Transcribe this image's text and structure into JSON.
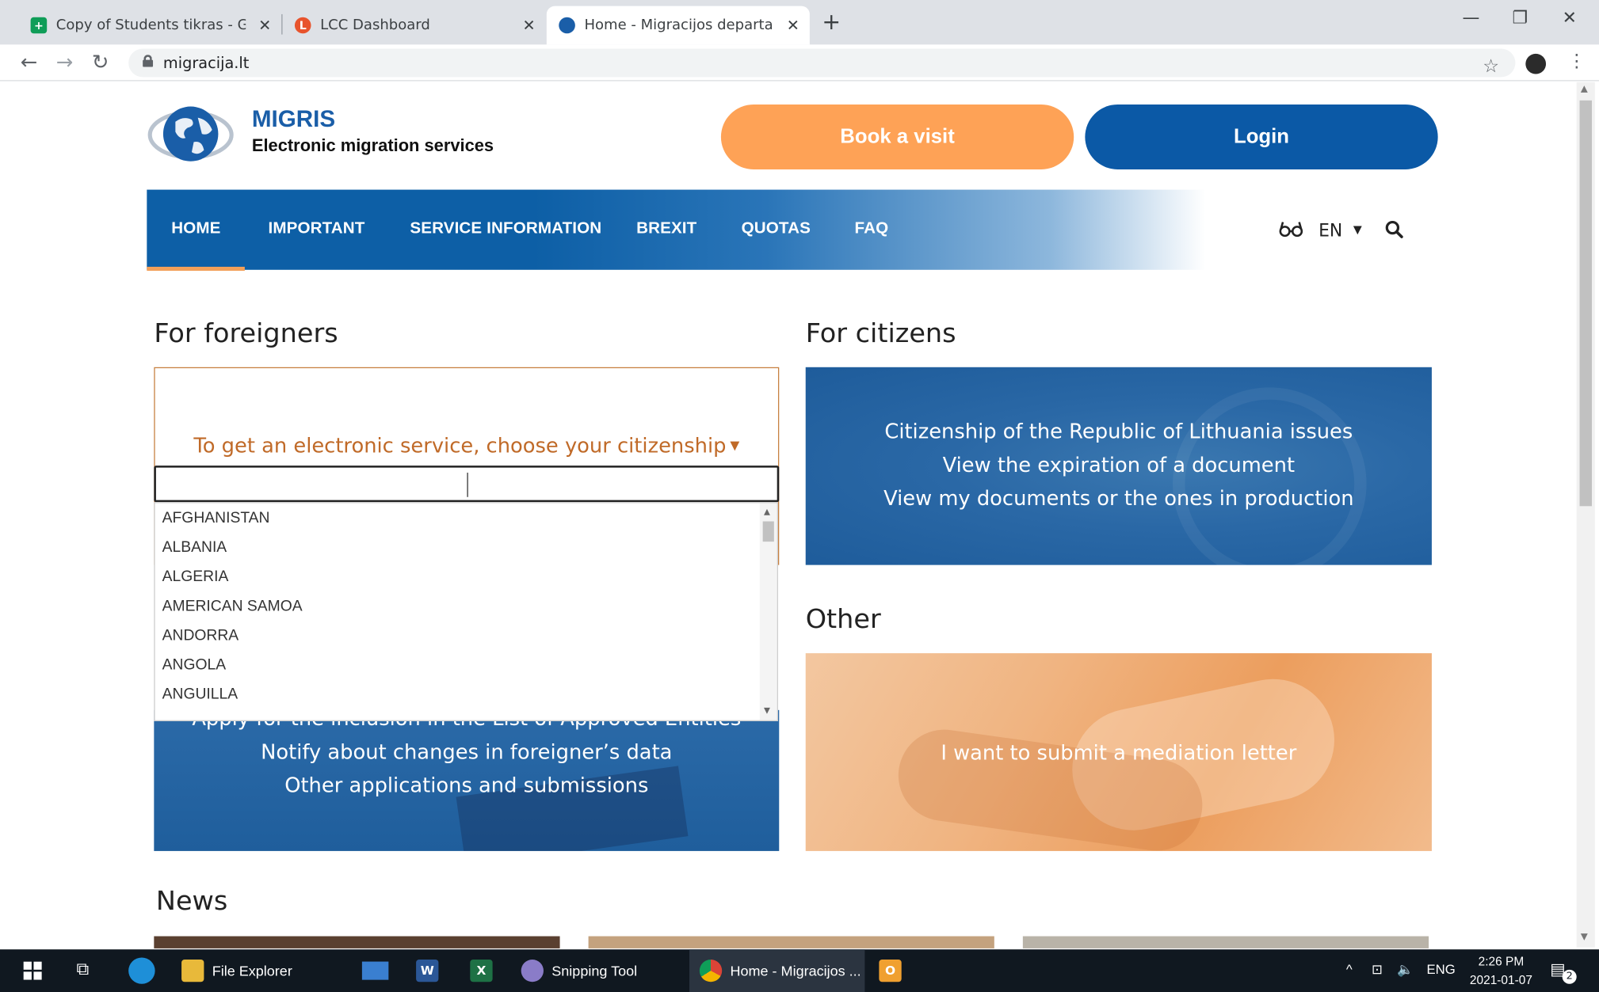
{
  "browser": {
    "tabs": [
      {
        "title": "Copy of Students tikras - Google",
        "icon": "sheets-icon",
        "color": "#0f9d58"
      },
      {
        "title": "LCC Dashboard",
        "icon": "lcc-icon",
        "color": "#e8542d"
      },
      {
        "title": "Home - Migracijos departamenta",
        "icon": "migris-icon",
        "color": "#1a5ea8"
      }
    ],
    "url": "migracija.lt"
  },
  "site": {
    "brand_name": "MIGRIS",
    "brand_tagline": "Electronic migration services",
    "book_label": "Book a visit",
    "login_label": "Login",
    "nav": [
      "HOME",
      "IMPORTANT",
      "SERVICE INFORMATION",
      "BREXIT",
      "QUOTAS",
      "FAQ"
    ],
    "active_nav": "HOME",
    "lang": "EN"
  },
  "sections": {
    "foreigners_title": "For foreigners",
    "citizenship_prompt": "To get an electronic service, choose your citizenship",
    "countries": [
      "AFGHANISTAN",
      "ALBANIA",
      "ALGERIA",
      "AMERICAN SAMOA",
      "ANDORRA",
      "ANGOLA",
      "ANGUILLA"
    ],
    "foreigner_links": [
      "Apply for the inclusion in the List of Approved Entities",
      "Notify about changes in foreigner’s data",
      "Other applications and submissions"
    ],
    "citizens_title": "For citizens",
    "citizen_links": [
      "Citizenship of the Republic of Lithuania issues",
      "View the expiration of a document",
      "View my documents or the ones in production"
    ],
    "other_title": "Other",
    "other_link": "I want to submit a mediation letter",
    "news_title": "News"
  },
  "taskbar": {
    "items": [
      "File Explorer",
      "Snipping Tool",
      "Home - Migracijos ..."
    ],
    "lang": "ENG",
    "time": "2:26 PM",
    "date": "2021-01-07",
    "notifications": "2"
  },
  "colors": {
    "brand_blue": "#0b59a6",
    "accent_orange": "#fea256",
    "prompt_orange": "#c06a28"
  }
}
